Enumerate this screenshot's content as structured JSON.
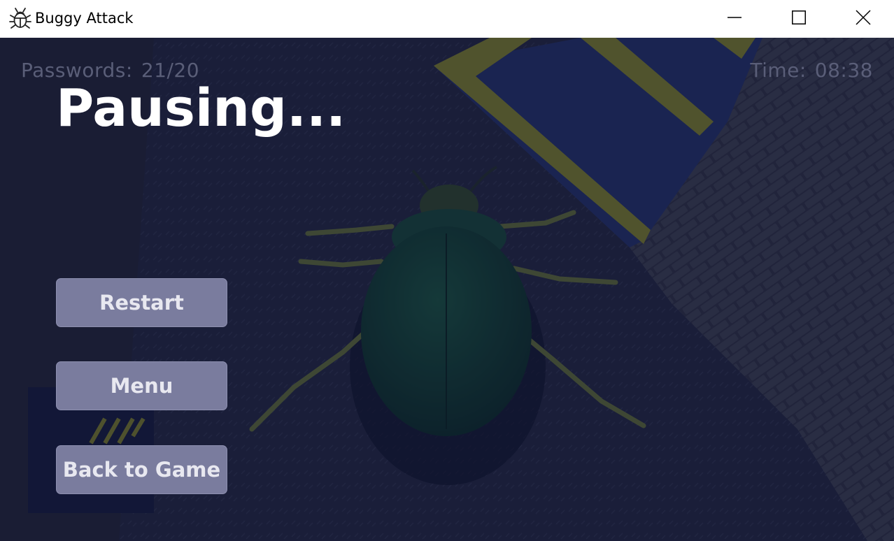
{
  "window": {
    "title": "Buggy Attack",
    "icon": "bug-icon",
    "controls": [
      "minimize-icon",
      "maximize-icon",
      "close-icon"
    ]
  },
  "hud": {
    "passwords_label": "Passwords:",
    "passwords_value": "21/20",
    "time_label": "Time:",
    "time_value": "08:38"
  },
  "pause": {
    "title": "Pausing..."
  },
  "menu": {
    "restart_label": "Restart",
    "menu_label": "Menu",
    "back_label": "Back to Game"
  },
  "colors": {
    "overlay": "#0c1030",
    "button_bg": "#7a7c9e",
    "button_text": "#e8e8f0",
    "hud_text": "#5a5e78",
    "title_text": "#ffffff"
  }
}
